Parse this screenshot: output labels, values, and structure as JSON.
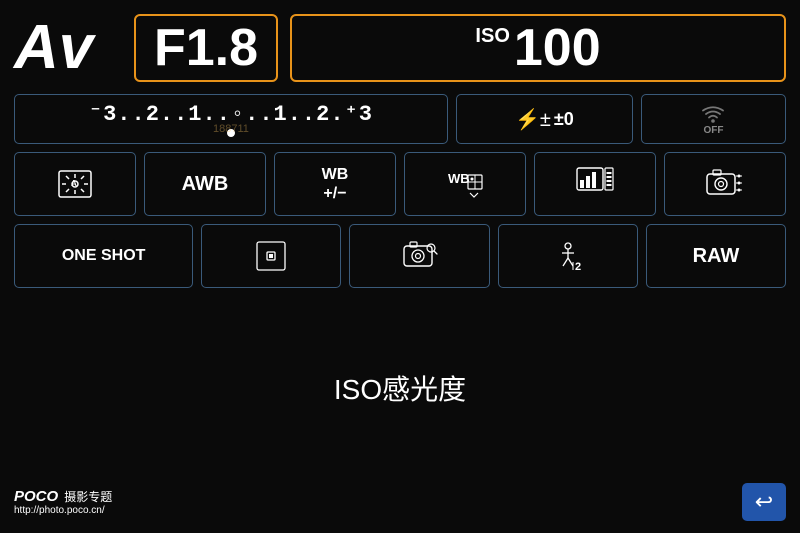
{
  "screen": {
    "background": "#0a0a0a"
  },
  "row1": {
    "mode": "Av",
    "aperture": "F1.8",
    "iso_label": "ISO",
    "iso_value": "100"
  },
  "row2": {
    "exposure_scale": "⁻3..2..1..0..1..2.⁺3",
    "exposure_scale_text": "-3..2..1..0..1..2.+3",
    "flash_label": "±0",
    "wifi_label": "OFF"
  },
  "row3": {
    "metering_label": "A",
    "wb_label": "AWB",
    "wb_adjust_label": "WB\n+/-",
    "wb_shift_label": "WB",
    "picture_style_label": "",
    "camera_settings_label": ""
  },
  "row4": {
    "af_mode": "ONE SHOT",
    "spot_label": "",
    "live_view_label": "",
    "timer_label": "2",
    "format_label": "RAW"
  },
  "row5": {
    "iso_full_label": "ISO感光度"
  },
  "bottom": {
    "brand": "POCO",
    "subtitle": "摄影专题",
    "url": "http://photo.poco.cn/",
    "back_icon": "↩"
  },
  "watermark": {
    "text": "188711"
  }
}
